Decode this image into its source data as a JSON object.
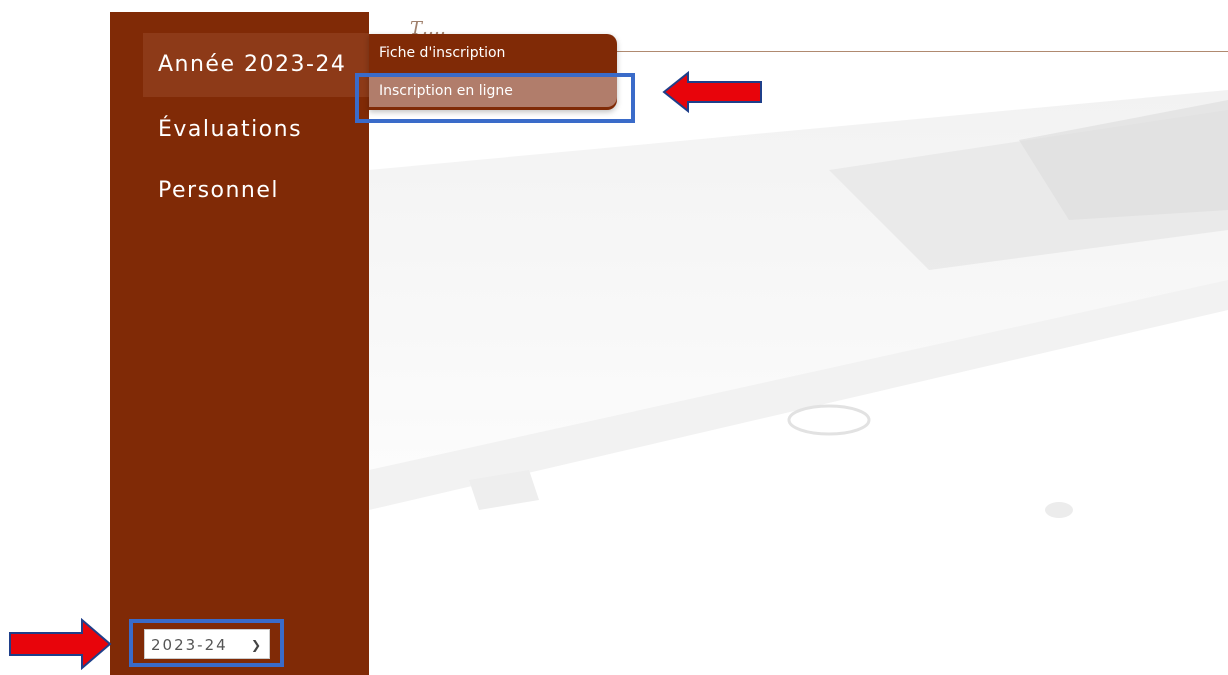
{
  "sidebar": {
    "items": [
      {
        "label": "Année 2023-24"
      },
      {
        "label": "Évaluations"
      },
      {
        "label": "Personnel"
      }
    ],
    "year_select": {
      "value": "2023-24",
      "icon": "chevron-down-icon"
    }
  },
  "dropdown": {
    "items": [
      {
        "label": "Fiche d'inscription"
      },
      {
        "label": "Inscription en ligne"
      }
    ]
  },
  "annotations": {
    "highlight_color": "#3a6bc9",
    "arrow_color": "#e8040b"
  },
  "colors": {
    "sidebar_bg": "#802a06",
    "active_item_bg": "#8d3a18",
    "hover_item_bg": "#b17d6b"
  }
}
